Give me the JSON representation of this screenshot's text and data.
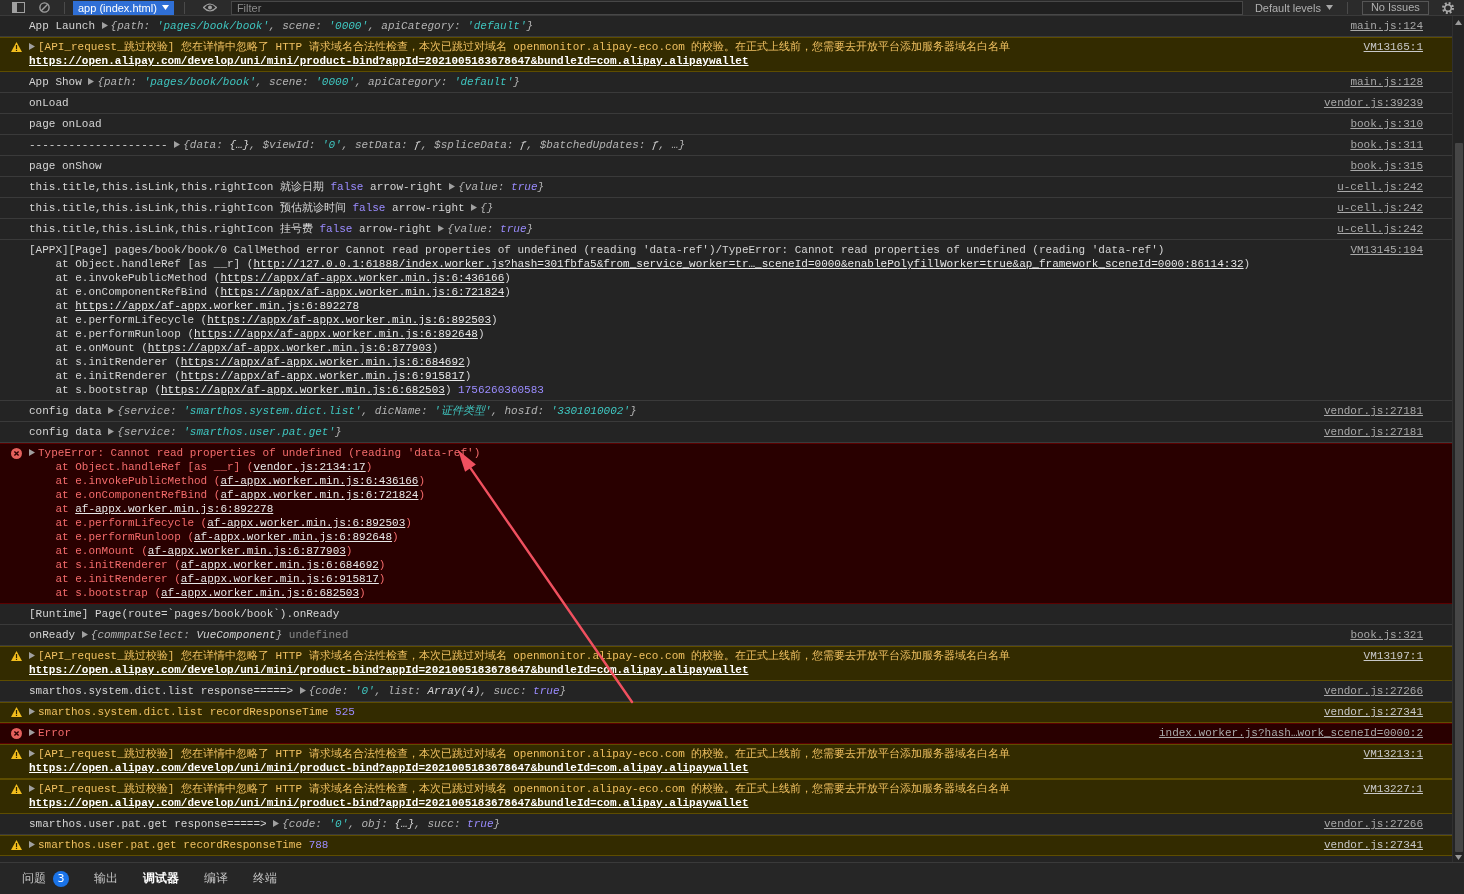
{
  "toolbar": {
    "context": "app (index.html)",
    "filter": {
      "placeholder": "Filter"
    },
    "levels": "Default levels",
    "issues": "No Issues"
  },
  "logs": [
    {
      "kind": "info",
      "parts": [
        {
          "kind": "text",
          "text": "App Launch"
        },
        {
          "kind": "object",
          "expanded": false,
          "tokens": [
            {
              "kind": "key",
              "text": "{path: "
            },
            {
              "kind": "string",
              "text": "'pages/book/book'"
            },
            {
              "kind": "key",
              "text": ", scene: "
            },
            {
              "kind": "string",
              "text": "'0000'"
            },
            {
              "kind": "key",
              "text": ", apiCategory: "
            },
            {
              "kind": "string",
              "text": "'default'"
            },
            {
              "kind": "key",
              "text": "}"
            }
          ]
        }
      ],
      "source": "main.js:124"
    },
    {
      "kind": "warning",
      "expanded": false,
      "parts": [
        {
          "kind": "text",
          "text": "[API_request_跳过校验] 您在详情中忽略了 HTTP 请求域名合法性检查，本次已跳过对域名 openmonitor.alipay-eco.com 的校验。在正式上线前，您需要去开放平台添加服务器域名白名单"
        },
        {
          "kind": "link",
          "text": "https://open.alipay.com/develop/uni/mini/product-bind?appId=2021005183678647&bundleId=com.alipay.alipaywallet"
        }
      ],
      "source": "VM13165:1"
    },
    {
      "kind": "info",
      "parts": [
        {
          "kind": "text",
          "text": "App Show"
        },
        {
          "kind": "object",
          "expanded": false,
          "tokens": [
            {
              "kind": "key",
              "text": "{path: "
            },
            {
              "kind": "string",
              "text": "'pages/book/book'"
            },
            {
              "kind": "key",
              "text": ", scene: "
            },
            {
              "kind": "string",
              "text": "'0000'"
            },
            {
              "kind": "key",
              "text": ", apiCategory: "
            },
            {
              "kind": "string",
              "text": "'default'"
            },
            {
              "kind": "key",
              "text": "}"
            }
          ]
        }
      ],
      "source": "main.js:128"
    },
    {
      "kind": "info",
      "parts": [
        {
          "kind": "text",
          "text": "onLoad"
        }
      ],
      "source": "vendor.js:39239"
    },
    {
      "kind": "info",
      "parts": [
        {
          "kind": "text",
          "text": "page onLoad"
        }
      ],
      "source": "book.js:310"
    },
    {
      "kind": "info",
      "parts": [
        {
          "kind": "text",
          "text": "---------------------"
        },
        {
          "kind": "object",
          "expanded": false,
          "tokens": [
            {
              "kind": "key",
              "text": "{data: "
            },
            {
              "kind": "value",
              "text": "{…}"
            },
            {
              "kind": "key",
              "text": ", $viewId: "
            },
            {
              "kind": "string",
              "text": "'0'"
            },
            {
              "kind": "key",
              "text": ", setData: "
            },
            {
              "kind": "value",
              "text": "ƒ"
            },
            {
              "kind": "key",
              "text": ", $spliceData: "
            },
            {
              "kind": "value",
              "text": "ƒ"
            },
            {
              "kind": "key",
              "text": ", $batchedUpdates: "
            },
            {
              "kind": "value",
              "text": "ƒ"
            },
            {
              "kind": "key",
              "text": ", …}"
            }
          ]
        }
      ],
      "source": "book.js:311"
    },
    {
      "kind": "info",
      "parts": [
        {
          "kind": "text",
          "text": "page onShow"
        }
      ],
      "source": "book.js:315"
    },
    {
      "kind": "info",
      "parts": [
        {
          "kind": "text",
          "text": "this.title,this.isLink,this.rightIcon 就诊日期"
        },
        {
          "kind": "boolean",
          "text": "false"
        },
        {
          "kind": "text",
          "text": "arrow-right"
        },
        {
          "kind": "object",
          "expanded": false,
          "tokens": [
            {
              "kind": "key",
              "text": "{value: "
            },
            {
              "kind": "boolean",
              "text": "true"
            },
            {
              "kind": "key",
              "text": "}"
            }
          ]
        }
      ],
      "source": "u-cell.js:242"
    },
    {
      "kind": "info",
      "parts": [
        {
          "kind": "text",
          "text": "this.title,this.isLink,this.rightIcon 预估就诊时间"
        },
        {
          "kind": "boolean",
          "text": "false"
        },
        {
          "kind": "text",
          "text": "arrow-right"
        },
        {
          "kind": "object",
          "expanded": false,
          "tokens": [
            {
              "kind": "key",
              "text": "{}"
            }
          ]
        }
      ],
      "source": "u-cell.js:242"
    },
    {
      "kind": "info",
      "parts": [
        {
          "kind": "text",
          "text": "this.title,this.isLink,this.rightIcon 挂号费"
        },
        {
          "kind": "boolean",
          "text": "false"
        },
        {
          "kind": "text",
          "text": "arrow-right"
        },
        {
          "kind": "object",
          "expanded": false,
          "tokens": [
            {
              "kind": "key",
              "text": "{value: "
            },
            {
              "kind": "boolean",
              "text": "true"
            },
            {
              "kind": "key",
              "text": "}"
            }
          ]
        }
      ],
      "source": "u-cell.js:242"
    },
    {
      "kind": "info",
      "parts": [
        {
          "kind": "text",
          "text": "[APPX][Page] pages/book/book/0 CallMethod error Cannot read properties of undefined (reading 'data-ref')/TypeError: Cannot read properties of undefined (reading 'data-ref')"
        }
      ],
      "stack": [
        {
          "text": "at Object.handleRef [as __r] (",
          "link": "http://127.0.0.1:61888/index.worker.js?hash=301fbfa5&from_service_worker=tr…_sceneId=0000&enablePolyfillWorker=true&ap_framework_sceneId=0000:86114:32",
          "close": ")"
        },
        {
          "text": "at e.invokePublicMethod (",
          "link": "https://appx/af-appx.worker.min.js:6:436166",
          "close": ")"
        },
        {
          "text": "at e.onComponentRefBind (",
          "link": "https://appx/af-appx.worker.min.js:6:721824",
          "close": ")"
        },
        {
          "text": "at ",
          "link": "https://appx/af-appx.worker.min.js:6:892278"
        },
        {
          "text": "at e.performLifecycle (",
          "link": "https://appx/af-appx.worker.min.js:6:892503",
          "close": ")"
        },
        {
          "text": "at e.performRunloop (",
          "link": "https://appx/af-appx.worker.min.js:6:892648",
          "close": ")"
        },
        {
          "text": "at e.onMount (",
          "link": "https://appx/af-appx.worker.min.js:6:877903",
          "close": ")"
        },
        {
          "text": "at s.initRenderer (",
          "link": "https://appx/af-appx.worker.min.js:6:684692",
          "close": ")"
        },
        {
          "text": "at e.initRenderer (",
          "link": "https://appx/af-appx.worker.min.js:6:915817",
          "close": ")"
        },
        {
          "text": "at s.bootstrap (",
          "link": "https://appx/af-appx.worker.min.js:6:682503",
          "close": ")",
          "note": "1756260360583"
        }
      ],
      "source": "VM13145:194"
    },
    {
      "kind": "info",
      "parts": [
        {
          "kind": "text",
          "text": "config data"
        },
        {
          "kind": "object",
          "expanded": false,
          "tokens": [
            {
              "kind": "key",
              "text": "{service: "
            },
            {
              "kind": "string",
              "text": "'smarthos.system.dict.list'"
            },
            {
              "kind": "key",
              "text": ", dicName: "
            },
            {
              "kind": "string",
              "text": "'证件类型'"
            },
            {
              "kind": "key",
              "text": ", hosId: "
            },
            {
              "kind": "string",
              "text": "'3301010002'"
            },
            {
              "kind": "key",
              "text": "}"
            }
          ]
        }
      ],
      "source": "vendor.js:27181"
    },
    {
      "kind": "info",
      "parts": [
        {
          "kind": "text",
          "text": "config data"
        },
        {
          "kind": "object",
          "expanded": false,
          "tokens": [
            {
              "kind": "key",
              "text": "{service: "
            },
            {
              "kind": "string",
              "text": "'smarthos.user.pat.get'"
            },
            {
              "kind": "key",
              "text": "}"
            }
          ]
        }
      ],
      "source": "vendor.js:27181"
    },
    {
      "kind": "error",
      "expanded": false,
      "parts": [
        {
          "kind": "text",
          "text": "TypeError: Cannot read properties of undefined (reading 'data-ref')"
        }
      ],
      "stack": [
        {
          "text": "at Object.handleRef [as __r] (",
          "link": "vendor.js:2134:17",
          "close": ")"
        },
        {
          "text": "at e.invokePublicMethod (",
          "link": "af-appx.worker.min.js:6:436166",
          "close": ")"
        },
        {
          "text": "at e.onComponentRefBind (",
          "link": "af-appx.worker.min.js:6:721824",
          "close": ")"
        },
        {
          "text": "at ",
          "link": "af-appx.worker.min.js:6:892278"
        },
        {
          "text": "at e.performLifecycle (",
          "link": "af-appx.worker.min.js:6:892503",
          "close": ")"
        },
        {
          "text": "at e.performRunloop (",
          "link": "af-appx.worker.min.js:6:892648",
          "close": ")"
        },
        {
          "text": "at e.onMount (",
          "link": "af-appx.worker.min.js:6:877903",
          "close": ")"
        },
        {
          "text": "at s.initRenderer (",
          "link": "af-appx.worker.min.js:6:684692",
          "close": ")"
        },
        {
          "text": "at e.initRenderer (",
          "link": "af-appx.worker.min.js:6:915817",
          "close": ")"
        },
        {
          "text": "at s.bootstrap (",
          "link": "af-appx.worker.min.js:6:682503",
          "close": ")"
        }
      ]
    },
    {
      "kind": "info",
      "parts": [
        {
          "kind": "text",
          "text": "[Runtime] Page(route=`pages/book/book`).onReady"
        }
      ]
    },
    {
      "kind": "info",
      "parts": [
        {
          "kind": "text",
          "text": "onReady"
        },
        {
          "kind": "object",
          "expanded": false,
          "tokens": [
            {
              "kind": "key",
              "text": "{commpatSelect: "
            },
            {
              "kind": "value",
              "text": "VueComponent"
            },
            {
              "kind": "key",
              "text": "}"
            }
          ]
        },
        {
          "kind": "undefined",
          "text": "undefined"
        }
      ],
      "source": "book.js:321"
    },
    {
      "kind": "warning",
      "expanded": false,
      "parts": [
        {
          "kind": "text",
          "text": "[API_request_跳过校验] 您在详情中忽略了 HTTP 请求域名合法性检查，本次已跳过对域名 openmonitor.alipay-eco.com 的校验。在正式上线前，您需要去开放平台添加服务器域名白名单"
        },
        {
          "kind": "link",
          "text": "https://open.alipay.com/develop/uni/mini/product-bind?appId=2021005183678647&bundleId=com.alipay.alipaywallet"
        }
      ],
      "source": "VM13197:1"
    },
    {
      "kind": "info",
      "parts": [
        {
          "kind": "text",
          "text": "smarthos.system.dict.list response=====>"
        },
        {
          "kind": "object",
          "expanded": false,
          "tokens": [
            {
              "kind": "key",
              "text": "{code: "
            },
            {
              "kind": "string",
              "text": "'0'"
            },
            {
              "kind": "key",
              "text": ", list: "
            },
            {
              "kind": "value",
              "text": "Array(4)"
            },
            {
              "kind": "key",
              "text": ", succ: "
            },
            {
              "kind": "boolean",
              "text": "true"
            },
            {
              "kind": "key",
              "text": "}"
            }
          ]
        }
      ],
      "source": "vendor.js:27266"
    },
    {
      "kind": "warning",
      "expanded": false,
      "parts": [
        {
          "kind": "text",
          "text": "smarthos.system.dict.list recordResponseTime"
        },
        {
          "kind": "number",
          "text": "525"
        }
      ],
      "source": "vendor.js:27341"
    },
    {
      "kind": "error",
      "expanded": false,
      "parts": [
        {
          "kind": "text",
          "text": "Error"
        }
      ],
      "source": "index.worker.js?hash…work_sceneId=0000:2"
    },
    {
      "kind": "warning",
      "expanded": false,
      "parts": [
        {
          "kind": "text",
          "text": "[API_request_跳过校验] 您在详情中忽略了 HTTP 请求域名合法性检查，本次已跳过对域名 openmonitor.alipay-eco.com 的校验。在正式上线前，您需要去开放平台添加服务器域名白名单"
        },
        {
          "kind": "link",
          "text": "https://open.alipay.com/develop/uni/mini/product-bind?appId=2021005183678647&bundleId=com.alipay.alipaywallet"
        }
      ],
      "source": "VM13213:1"
    },
    {
      "kind": "warning",
      "expanded": false,
      "parts": [
        {
          "kind": "text",
          "text": "[API_request_跳过校验] 您在详情中忽略了 HTTP 请求域名合法性检查，本次已跳过对域名 openmonitor.alipay-eco.com 的校验。在正式上线前，您需要去开放平台添加服务器域名白名单"
        },
        {
          "kind": "link",
          "text": "https://open.alipay.com/develop/uni/mini/product-bind?appId=2021005183678647&bundleId=com.alipay.alipaywallet"
        }
      ],
      "source": "VM13227:1"
    },
    {
      "kind": "info",
      "parts": [
        {
          "kind": "text",
          "text": "smarthos.user.pat.get response=====>"
        },
        {
          "kind": "object",
          "expanded": false,
          "tokens": [
            {
              "kind": "key",
              "text": "{code: "
            },
            {
              "kind": "string",
              "text": "'0'"
            },
            {
              "kind": "key",
              "text": ", obj: "
            },
            {
              "kind": "value",
              "text": "{…}"
            },
            {
              "kind": "key",
              "text": ", succ: "
            },
            {
              "kind": "boolean",
              "text": "true"
            },
            {
              "kind": "key",
              "text": "}"
            }
          ]
        }
      ],
      "source": "vendor.js:27266"
    },
    {
      "kind": "warning",
      "expanded": false,
      "parts": [
        {
          "kind": "text",
          "text": "smarthos.user.pat.get recordResponseTime"
        },
        {
          "kind": "number",
          "text": "788"
        }
      ],
      "source": "vendor.js:27341"
    }
  ],
  "panel_tabs": [
    {
      "label": "问题",
      "badge": "3",
      "selected": false
    },
    {
      "label": "输出",
      "selected": false
    },
    {
      "label": "调试器",
      "selected": true
    },
    {
      "label": "编译",
      "selected": false
    },
    {
      "label": "终端",
      "selected": false
    }
  ]
}
